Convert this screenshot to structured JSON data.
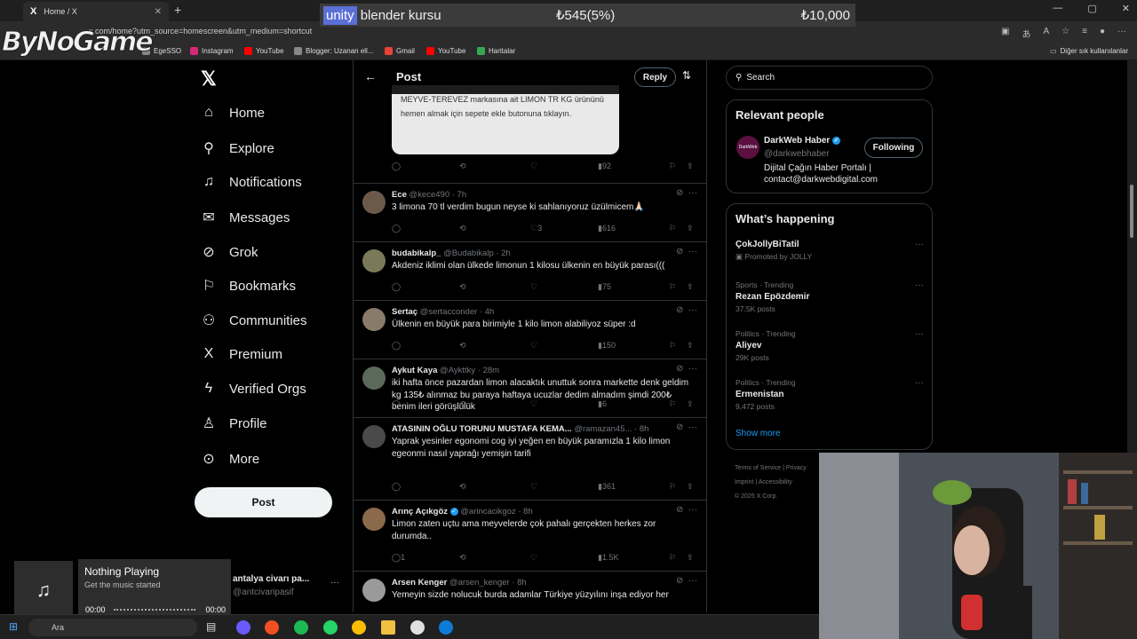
{
  "browser": {
    "tab_title": "Home / X",
    "url": "x.com/home?utm_source=homescreen&utm_medium=shortcut",
    "overlay_query": "unity",
    "overlay_rest": "blender kursu",
    "overlay_price": "₺545(5%)",
    "overlay_total": "₺10,000",
    "watermark": "ByNoGame",
    "bookmarks": [
      {
        "label": "EgeSSO",
        "color": "#888888"
      },
      {
        "label": "Instagram",
        "color": "#d62976"
      },
      {
        "label": "YouTube",
        "color": "#ff0000"
      },
      {
        "label": "Blogger: Uzanan ell...",
        "color": "#888888"
      },
      {
        "label": "Gmail",
        "color": "#ea4335"
      },
      {
        "label": "YouTube",
        "color": "#ff0000"
      },
      {
        "label": "Haritalar",
        "color": "#34a853"
      }
    ],
    "bookmarks_right": "Diğer sık kullanılanlar"
  },
  "nav": {
    "items": [
      {
        "label": "Home",
        "icon": "home-icon",
        "glyph": "⌂"
      },
      {
        "label": "Explore",
        "icon": "search-icon",
        "glyph": "⚲"
      },
      {
        "label": "Notifications",
        "icon": "bell-icon",
        "glyph": "♫"
      },
      {
        "label": "Messages",
        "icon": "envelope-icon",
        "glyph": "✉"
      },
      {
        "label": "Grok",
        "icon": "grok-icon",
        "glyph": "⊘"
      },
      {
        "label": "Bookmarks",
        "icon": "bookmark-icon",
        "glyph": "⚐"
      },
      {
        "label": "Communities",
        "icon": "people-icon",
        "glyph": "⚇"
      },
      {
        "label": "Premium",
        "icon": "x-icon",
        "glyph": "X"
      },
      {
        "label": "Verified Orgs",
        "icon": "lightning-icon",
        "glyph": "ϟ"
      },
      {
        "label": "Profile",
        "icon": "person-icon",
        "glyph": "♙"
      },
      {
        "label": "More",
        "icon": "more-circle-icon",
        "glyph": "⊙"
      }
    ],
    "post_button": "Post",
    "account_name": "antalya civarı pa...",
    "account_handle": "@antcivaripasif"
  },
  "music": {
    "title": "Nothing Playing",
    "subtitle": "Get the music started",
    "time_start": "00:00",
    "time_end": "00:00"
  },
  "center": {
    "header_title": "Post",
    "reply_button": "Reply",
    "quote_card_text": "MEYVE-TEREVEZ markasına ait LIMON TR KG ürününü hemen almak için sepete ekle butonuna tıklayın.",
    "first_actions_views": "92",
    "tweets": [
      {
        "name": "Ece",
        "handle": "@kece490",
        "time": "· 7h",
        "text": "3 limona 70 tl verdim bugun neyse ki sahlanıyoruz üzülmicem🙏🏻",
        "replies": "",
        "likes": "3",
        "views": "616",
        "verified": false,
        "avatar": "#6b5a4a"
      },
      {
        "name": "budabikalp_",
        "handle": "@Budabikalp",
        "time": "· 2h",
        "text": "Akdeniz iklimi olan ülkede limonun 1 kilosu ülkenin en büyük parası(((",
        "replies": "",
        "likes": "",
        "views": "75",
        "verified": false,
        "avatar": "#7a7a5a"
      },
      {
        "name": "Sertaç",
        "handle": "@sertacconder",
        "time": "· 4h",
        "text": "Ülkenin en büyük para birimiyle 1 kilo limon alabiliyoz süper :d",
        "replies": "",
        "likes": "",
        "views": "150",
        "verified": false,
        "avatar": "#8a7a6a"
      },
      {
        "name": "Aykut Kaya",
        "handle": "@Aykttky",
        "time": "· 28m",
        "text": "iki hafta önce pazardan limon alacaktık unuttuk sonra markette denk geldim kg 135₺ alınmaz bu paraya haftaya ucuzlar dedim almadım şimdi 200₺ benim ileri görüşlülük",
        "replies": "",
        "likes": "",
        "views": "6",
        "verified": false,
        "avatar": "#5a6a5a"
      },
      {
        "name": "ATASININ OĞLU TORUNU MUSTAFA KEMA...",
        "handle": "@ramazan45...",
        "time": "· 8h",
        "text": "Yaprak yesinler egonomi cog iyi yeğen en büyük paramızla 1 kilo limon egeonmi nasıl yaprağı yemişin tarifi",
        "replies": "",
        "likes": "",
        "views": "361",
        "verified": false,
        "avatar": "#4a4a4a"
      },
      {
        "name": "Arınç Açıkgöz",
        "handle": "@arincacikgoz",
        "time": "· 8h",
        "text": "Limon zaten uçtu ama meyvelerde çok pahalı gerçekten herkes zor durumda..",
        "replies": "1",
        "likes": "",
        "views": "1.5K",
        "verified": true,
        "avatar": "#8a6a4a"
      },
      {
        "name": "Arsen Kenger",
        "handle": "@arsen_kenger",
        "time": "· 8h",
        "text": "Yemeyin sizde nolucuk burda adamlar Türkiye yüzyılını inşa ediyor her",
        "replies": "",
        "likes": "",
        "views": "",
        "verified": false,
        "avatar": "#9a9a9a"
      }
    ]
  },
  "right": {
    "search_placeholder": "Search",
    "relevant_title": "Relevant people",
    "person_name": "DarkWeb Haber",
    "person_handle": "@darkwebhaber",
    "person_bio": "Dijital Çağın Haber Portalı | contact@darkwebdigital.com",
    "person_avatar_text": "DarkWeb",
    "follow_button": "Following",
    "happening_title": "What’s happening",
    "trends": [
      {
        "category": "",
        "name": "ÇokJollyBiTatil",
        "count": "Promoted by JOLLY"
      },
      {
        "category": "Sports · Trending",
        "name": "Rezan Epözdemir",
        "count": "37.5K posts"
      },
      {
        "category": "Politics · Trending",
        "name": "Aliyev",
        "count": "29K posts"
      },
      {
        "category": "Politics · Trending",
        "name": "Ermenistan",
        "count": "9,472 posts"
      }
    ],
    "show_more": "Show more",
    "footer": [
      "Terms of Service",
      "Privacy",
      "Imprint",
      "Accessibility",
      "© 2025 X Corp."
    ]
  },
  "taskbar": {
    "search_text": "Ara"
  }
}
